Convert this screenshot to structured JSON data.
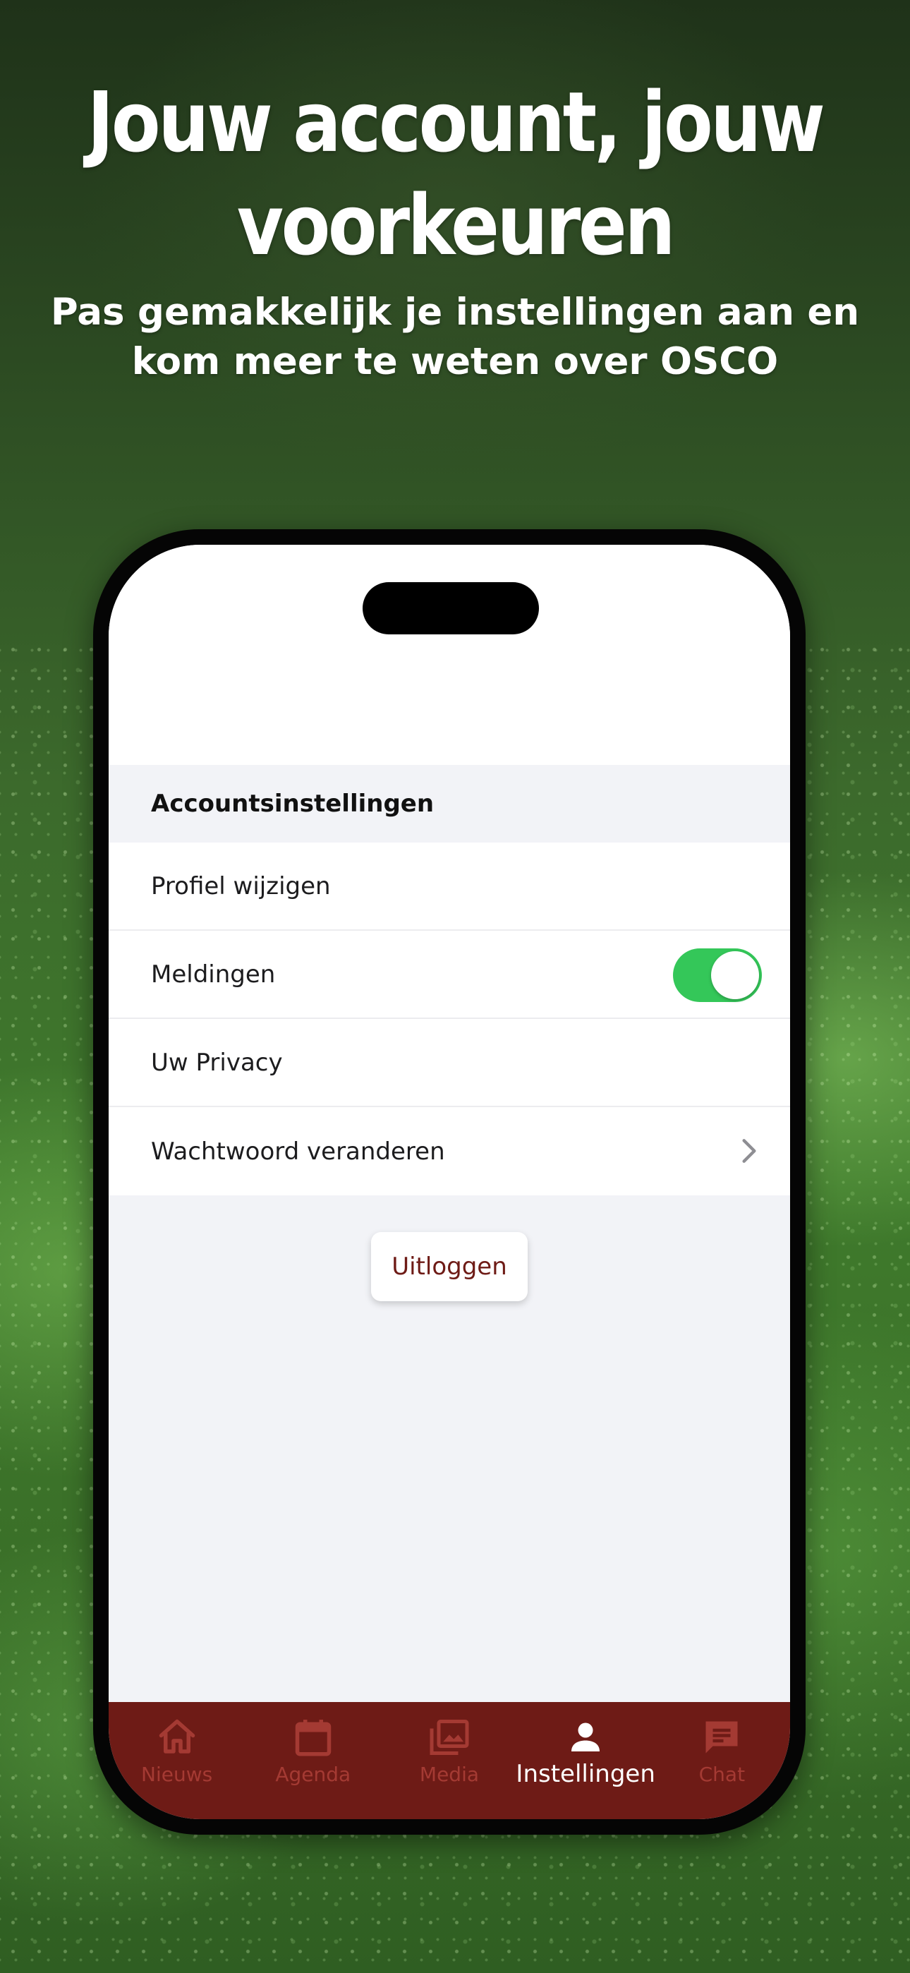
{
  "promo": {
    "headline_line1": "Jouw account, jouw",
    "headline_line2": "voorkeuren",
    "subline_line1": "Pas gemakkelijk je instellingen aan en",
    "subline_line2": "kom meer te weten over OSCO"
  },
  "settings": {
    "section_title": "Accountsinstellingen",
    "rows": [
      {
        "label": "Profiel wijzigen"
      },
      {
        "label": "Meldingen",
        "toggle_on": true
      },
      {
        "label": "Uw Privacy"
      },
      {
        "label": "Wachtwoord veranderen",
        "icon": "chevron-right-icon"
      }
    ],
    "logout_label": "Uitloggen"
  },
  "tabbar": {
    "tabs": [
      {
        "label": "Nieuws",
        "icon": "home-icon"
      },
      {
        "label": "Agenda",
        "icon": "calendar-icon"
      },
      {
        "label": "Media",
        "icon": "photo-library-icon"
      },
      {
        "label": "Instellingen",
        "icon": "person-icon",
        "active": true
      },
      {
        "label": "Chat",
        "icon": "chat-icon"
      }
    ]
  },
  "colors": {
    "brand": "#6e1b16",
    "tab_inactive": "#a43a33",
    "toggle_on": "#34c759",
    "background": "#f2f3f7"
  }
}
